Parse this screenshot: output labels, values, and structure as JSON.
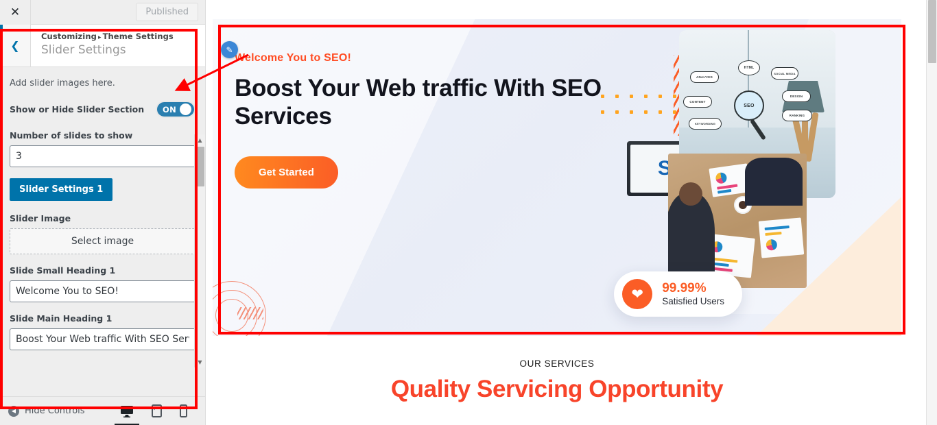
{
  "customizer": {
    "close_icon": "close-icon",
    "publish_label": "Published",
    "back_icon": "chevron-left-icon",
    "breadcrumb_root": "Customizing",
    "breadcrumb_sep": "▸",
    "breadcrumb_parent": "Theme Settings",
    "section_title": "Slider Settings",
    "description": "Add slider images here.",
    "toggle_label": "Show or Hide Slider Section",
    "toggle_state": "ON",
    "slides_count_label": "Number of slides to show",
    "slides_count_value": "3",
    "slider_settings_button": "Slider Settings 1",
    "slider_image_label": "Slider Image",
    "select_image_label": "Select image",
    "small_heading_label": "Slide Small Heading 1",
    "small_heading_value": "Welcome You to SEO!",
    "main_heading_label": "Slide Main Heading 1",
    "main_heading_value": "Boost Your Web traffic With SEO Services",
    "footer": {
      "hide_controls": "Hide Controls",
      "device_desktop": "desktop-icon",
      "device_tablet": "tablet-icon",
      "device_mobile": "mobile-icon"
    },
    "accent_color": "#0073aa",
    "toggle_color": "#2a7fb0"
  },
  "preview": {
    "hero": {
      "kicker": "Welcome You to SEO!",
      "title": "Boost Your Web traffic With SEO Services",
      "cta_label": "Get Started",
      "kicker_color": "#ff4d24",
      "cta_gradient_from": "#ff8a1f",
      "cta_gradient_to": "#fb5d26"
    },
    "badge": {
      "heart_icon": "heart-icon",
      "percent": "99.99%",
      "caption": "Satisfied Users",
      "color": "#fb5d26"
    },
    "illustration": {
      "monitor_text": "SI",
      "doodles": {
        "seo": "SEO",
        "html": "HTML",
        "analysis": "ANALYSIS",
        "content": "CONTENT",
        "keywording": "KEYWORDING",
        "social": "SOCIAL MEDIA",
        "design": "DESIGN",
        "ranking": "RANKING"
      }
    },
    "services": {
      "kicker": "OUR SERVICES",
      "title": "Quality Servicing Opportunity",
      "title_color": "#f8442a",
      "edit_icon": "edit-pencil-icon"
    }
  }
}
